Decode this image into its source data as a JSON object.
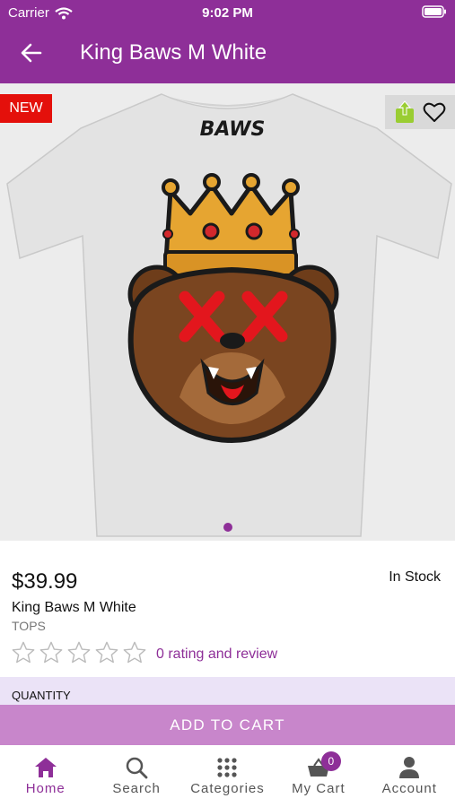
{
  "status_bar": {
    "carrier": "Carrier",
    "time": "9:02 PM"
  },
  "header": {
    "title": "King Baws M White"
  },
  "product": {
    "badge": "NEW",
    "shirt_text": "BAWS",
    "price": "$39.99",
    "stock": "In Stock",
    "name": "King Baws M White",
    "category": "TOPS",
    "rating_stars": 0,
    "rating_text": "0 rating and review",
    "quantity_label": "QUANTITY",
    "add_to_cart": "ADD TO CART"
  },
  "tabs": [
    {
      "label": "Home",
      "icon": "home-icon"
    },
    {
      "label": "Search",
      "icon": "search-icon"
    },
    {
      "label": "Categories",
      "icon": "grid-icon"
    },
    {
      "label": "My Cart",
      "icon": "basket-icon",
      "badge": "0"
    },
    {
      "label": "Account",
      "icon": "person-icon"
    }
  ],
  "colors": {
    "accent": "#8e2f98",
    "new_badge": "#e4100b",
    "share": "#9acd32",
    "add_to_cart_bg": "#c886cb"
  }
}
